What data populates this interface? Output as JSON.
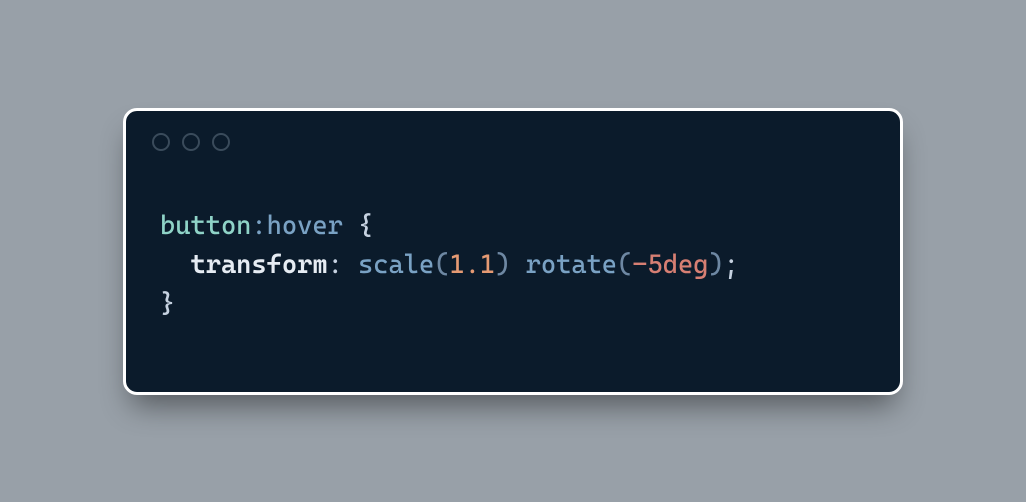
{
  "window": {
    "traffic_lights": [
      "close",
      "minimize",
      "zoom"
    ]
  },
  "code": {
    "selector": "button",
    "pseudo": ":hover",
    "open_brace": " {",
    "indent": "  ",
    "property": "transform",
    "colon_sp": ": ",
    "fn1": "scale",
    "lp1": "(",
    "arg1": "1.1",
    "rp1": ")",
    "space": " ",
    "fn2": "rotate",
    "lp2": "(",
    "arg2": "-5deg",
    "rp2": ")",
    "semi": ";",
    "close_brace": "}"
  }
}
